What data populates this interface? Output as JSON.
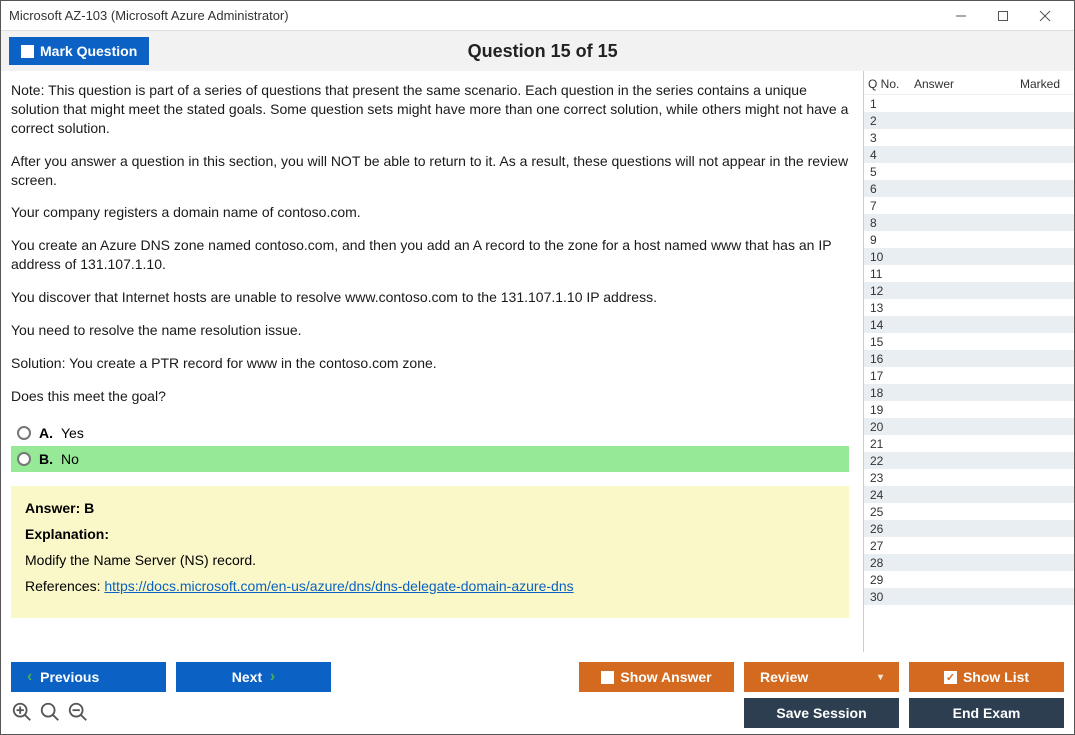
{
  "window": {
    "title": "Microsoft AZ-103 (Microsoft Azure Administrator)"
  },
  "toolbar": {
    "mark_label": "Mark Question",
    "heading": "Question 15 of 15"
  },
  "question": {
    "paragraphs": [
      "Note: This question is part of a series of questions that present the same scenario. Each question in the series contains a unique solution that might meet the stated goals. Some question sets might have more than one correct solution, while others might not have a correct solution.",
      "After you answer a question in this section, you will NOT be able to return to it. As a result, these questions will not appear in the review screen.",
      "Your company registers a domain name of contoso.com.",
      "You create an Azure DNS zone named contoso.com, and then you add an A record to the zone for a host named www that has an IP address of 131.107.1.10.",
      "You discover that Internet hosts are unable to resolve www.contoso.com to the 131.107.1.10 IP address.",
      "You need to resolve the name resolution issue.",
      "Solution: You create a PTR record for www in the contoso.com zone.",
      "Does this meet the goal?"
    ],
    "options": [
      {
        "letter": "A.",
        "text": "Yes",
        "correct": false
      },
      {
        "letter": "B.",
        "text": "No",
        "correct": true
      }
    ]
  },
  "answer_box": {
    "answer_line": "Answer: B",
    "explanation_label": "Explanation:",
    "explanation_text": "Modify the Name Server (NS) record.",
    "references_label": "References: ",
    "reference_url": "https://docs.microsoft.com/en-us/azure/dns/dns-delegate-domain-azure-dns"
  },
  "side": {
    "headers": {
      "qno": "Q No.",
      "answer": "Answer",
      "marked": "Marked"
    },
    "row_count": 30
  },
  "buttons": {
    "previous": "Previous",
    "next": "Next",
    "show_answer": "Show Answer",
    "review": "Review",
    "show_list": "Show List",
    "save_session": "Save Session",
    "end_exam": "End Exam"
  }
}
